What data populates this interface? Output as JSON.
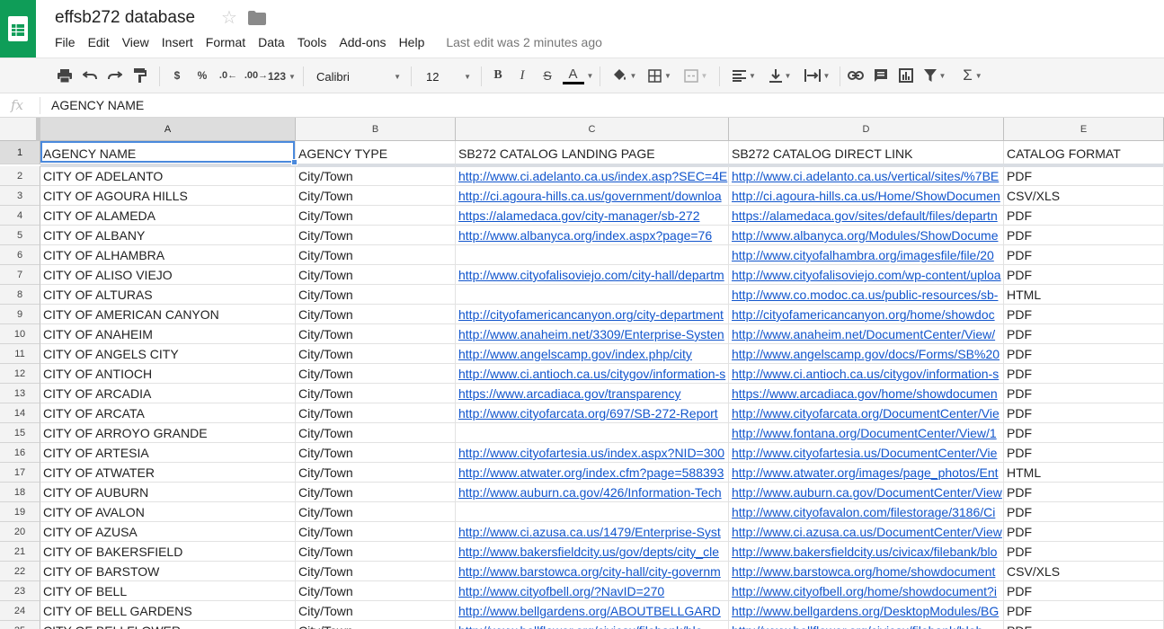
{
  "app": {
    "title": "effsb272 database",
    "last_edit": "Last edit was 2 minutes ago",
    "menu": [
      "File",
      "Edit",
      "View",
      "Insert",
      "Format",
      "Data",
      "Tools",
      "Add-ons",
      "Help"
    ]
  },
  "toolbar": {
    "currency": "$",
    "percent": "%",
    "dec_decrease": ".0←",
    "dec_increase": ".00→",
    "number_format": "123",
    "font": "Calibri",
    "font_size": "12",
    "bold": "B",
    "italic": "I",
    "strike": "S",
    "text_color": "A"
  },
  "formula": {
    "label": "fx",
    "value": "AGENCY NAME"
  },
  "grid": {
    "columns": [
      "A",
      "B",
      "C",
      "D",
      "E"
    ],
    "selected_column": "A",
    "header_row": [
      "AGENCY NAME",
      "AGENCY TYPE",
      "SB272 CATALOG LANDING PAGE",
      "SB272 CATALOG DIRECT LINK",
      "CATALOG FORMAT"
    ],
    "rows": [
      [
        "CITY OF ADELANTO",
        "City/Town",
        "http://www.ci.adelanto.ca.us/index.asp?SEC=4E",
        "http://www.ci.adelanto.ca.us/vertical/sites/%7BE",
        "PDF"
      ],
      [
        "CITY OF AGOURA HILLS",
        "City/Town",
        "http://ci.agoura-hills.ca.us/government/downloa",
        "http://ci.agoura-hills.ca.us/Home/ShowDocumen",
        "CSV/XLS"
      ],
      [
        "CITY OF ALAMEDA",
        "City/Town",
        "https://alamedaca.gov/city-manager/sb-272",
        "https://alamedaca.gov/sites/default/files/departn",
        "PDF"
      ],
      [
        "CITY OF ALBANY",
        "City/Town",
        "http://www.albanyca.org/index.aspx?page=76",
        "http://www.albanyca.org/Modules/ShowDocume",
        "PDF"
      ],
      [
        "CITY OF ALHAMBRA",
        "City/Town",
        "",
        "http://www.cityofalhambra.org/imagesfile/file/20",
        "PDF"
      ],
      [
        "CITY OF ALISO VIEJO",
        "City/Town",
        "http://www.cityofalisoviejo.com/city-hall/departm",
        "http://www.cityofalisoviejo.com/wp-content/uploa",
        "PDF"
      ],
      [
        "CITY OF ALTURAS",
        "City/Town",
        "",
        "http://www.co.modoc.ca.us/public-resources/sb-",
        "HTML"
      ],
      [
        "CITY OF AMERICAN CANYON",
        "City/Town",
        "http://cityofamericancanyon.org/city-department",
        "http://cityofamericancanyon.org/home/showdoc",
        "PDF"
      ],
      [
        "CITY OF ANAHEIM",
        "City/Town",
        "http://www.anaheim.net/3309/Enterprise-Systen",
        "http://www.anaheim.net/DocumentCenter/View/",
        "PDF"
      ],
      [
        "CITY OF ANGELS CITY",
        "City/Town",
        "http://www.angelscamp.gov/index.php/city",
        "http://www.angelscamp.gov/docs/Forms/SB%20",
        "PDF"
      ],
      [
        "CITY OF ANTIOCH",
        "City/Town",
        "http://www.ci.antioch.ca.us/citygov/information-s",
        "http://www.ci.antioch.ca.us/citygov/information-s",
        "PDF"
      ],
      [
        "CITY OF ARCADIA",
        "City/Town",
        "https://www.arcadiaca.gov/transparency",
        "https://www.arcadiaca.gov/home/showdocumen",
        "PDF"
      ],
      [
        "CITY OF ARCATA",
        "City/Town",
        "http://www.cityofarcata.org/697/SB-272-Report",
        "http://www.cityofarcata.org/DocumentCenter/Vie",
        "PDF"
      ],
      [
        "CITY OF ARROYO GRANDE",
        "City/Town",
        "",
        "http://www.fontana.org/DocumentCenter/View/1",
        "PDF"
      ],
      [
        "CITY OF ARTESIA",
        "City/Town",
        "http://www.cityofartesia.us/index.aspx?NID=300",
        "http://www.cityofartesia.us/DocumentCenter/Vie",
        "PDF"
      ],
      [
        "CITY OF ATWATER",
        "City/Town",
        "http://www.atwater.org/index.cfm?page=588393",
        "http://www.atwater.org/images/page_photos/Ent",
        "HTML"
      ],
      [
        "CITY OF AUBURN",
        "City/Town",
        "http://www.auburn.ca.gov/426/Information-Tech",
        "http://www.auburn.ca.gov/DocumentCenter/View",
        "PDF"
      ],
      [
        "CITY OF AVALON",
        "City/Town",
        "",
        "http://www.cityofavalon.com/filestorage/3186/Ci",
        "PDF"
      ],
      [
        "CITY OF AZUSA",
        "City/Town",
        "http://www.ci.azusa.ca.us/1479/Enterprise-Syst",
        "http://www.ci.azusa.ca.us/DocumentCenter/View",
        "PDF"
      ],
      [
        "CITY OF BAKERSFIELD",
        "City/Town",
        "http://www.bakersfieldcity.us/gov/depts/city_cle",
        "http://www.bakersfieldcity.us/civicax/filebank/blo",
        "PDF"
      ],
      [
        "CITY OF BARSTOW",
        "City/Town",
        "http://www.barstowca.org/city-hall/city-governm",
        "http://www.barstowca.org/home/showdocument",
        "CSV/XLS"
      ],
      [
        "CITY OF BELL",
        "City/Town",
        "http://www.cityofbell.org/?NavID=270",
        "http://www.cityofbell.org/home/showdocument?i",
        "PDF"
      ],
      [
        "CITY OF BELL GARDENS",
        "City/Town",
        "http://www.bellgardens.org/ABOUTBELLGARD",
        "http://www.bellgardens.org/DesktopModules/BG",
        "PDF"
      ],
      [
        "CITY OF BELLFLOWER",
        "City/Town",
        "http://www.bellflower.org/civicax/filebank/blo",
        "http://www.bellflower.org/civicax/filebank/blob",
        "PDF"
      ]
    ]
  }
}
